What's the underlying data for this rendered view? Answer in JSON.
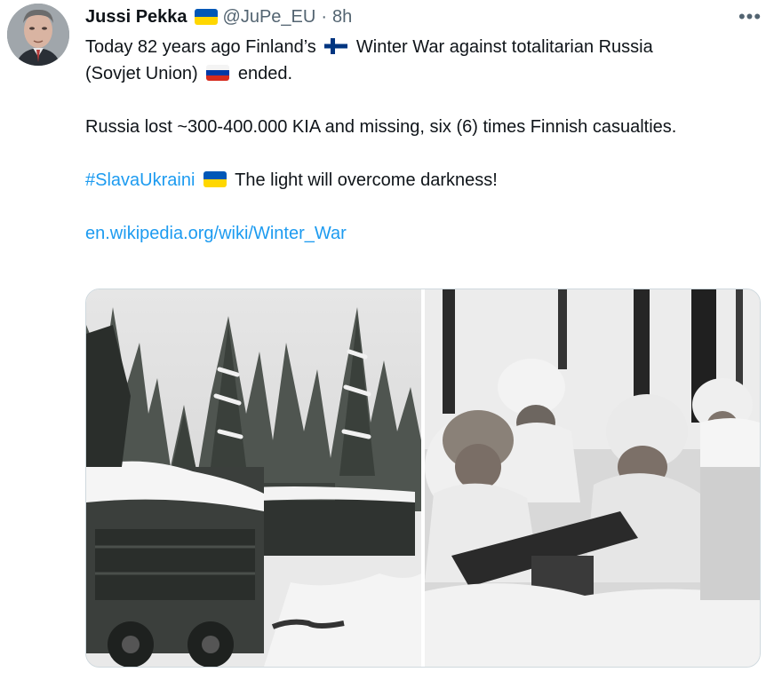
{
  "tweet": {
    "author": {
      "name": "Jussi Pekka",
      "handle": "@JuPe_EU",
      "time": "8h",
      "separator": "·"
    },
    "text": {
      "line1_before_flag": "Today 82 years ago Finland’s",
      "line1_after_flag": "Winter War against totalitarian Russia",
      "line2_before_flag": "(Sovjet Union)",
      "line2_after_flag": "ended.",
      "para2": "Russia lost ~300-400.000 KIA and missing, six (6) times Finnish casualties.",
      "hashtag": "#SlavaUkraini",
      "para3_after": "The light will overcome darkness!",
      "link": "en.wikipedia.org/wiki/Winter_War"
    },
    "more_label": "•••",
    "media": [
      {
        "icon": "photo-destroyed-vehicles-snow-forest"
      },
      {
        "icon": "photo-finnish-soldiers-machine-gun"
      }
    ]
  },
  "colors": {
    "link": "#1d9bf0",
    "secondary_text": "#536471",
    "ukraine_blue": "#0057b7",
    "ukraine_yellow": "#ffd700",
    "finland_blue": "#003580",
    "russia_red": "#d52b1e",
    "russia_blue": "#0039a6"
  }
}
